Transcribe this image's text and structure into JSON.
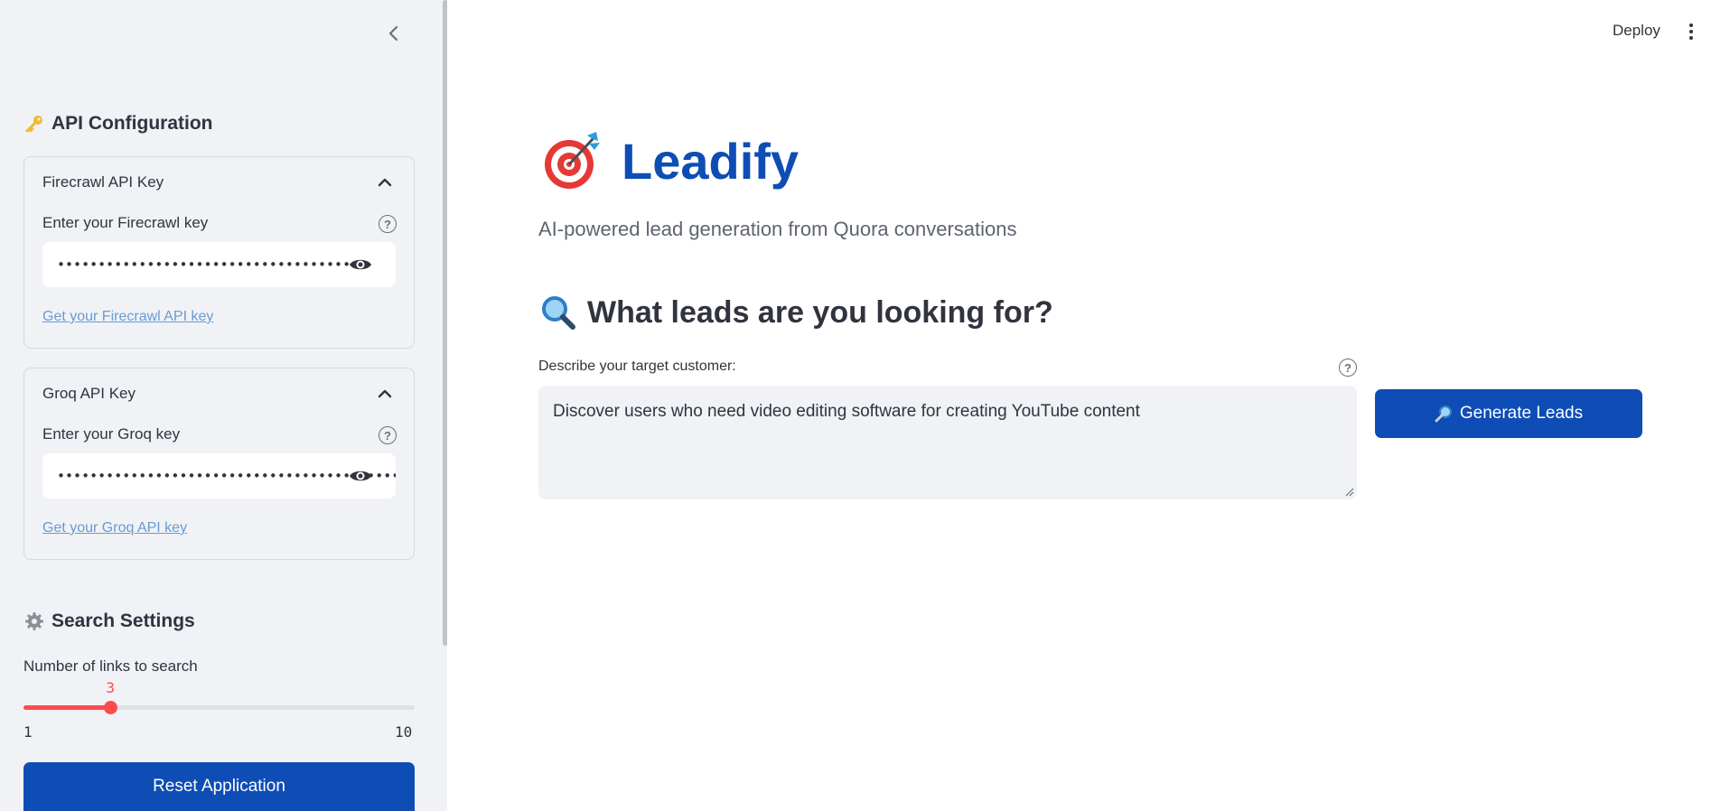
{
  "sidebar": {
    "api_section_title": "API Configuration",
    "api_section_icon": "key-icon",
    "firecrawl": {
      "header": "Firecrawl API Key",
      "label": "Enter your Firecrawl key",
      "value": "••••••••••••••••••••••••••••••••••••",
      "link": "Get your Firecrawl API key"
    },
    "groq": {
      "header": "Groq API Key",
      "label": "Enter your Groq key",
      "value": "••••••••••••••••••••••••••••••••••••••••••••••••••",
      "link": "Get your Groq API key"
    },
    "search_section_title": "Search Settings",
    "search_section_icon": "gear-icon",
    "slider": {
      "label": "Number of links to search",
      "value": "3",
      "min": "1",
      "max": "10",
      "value_num": 3,
      "min_num": 1,
      "max_num": 10,
      "accent": "#FF4B4B"
    },
    "reset_label": "Reset Application"
  },
  "topbar": {
    "deploy_label": "Deploy"
  },
  "main": {
    "title": "Leadify",
    "subtitle": "AI-powered lead generation from Quora conversations",
    "query_heading": "What leads are you looking for?",
    "textarea_label": "Describe your target customer:",
    "textarea_value": "Discover users who need video editing software for creating YouTube content",
    "generate_label": "Generate Leads",
    "brand_color": "#0E4DB5"
  }
}
